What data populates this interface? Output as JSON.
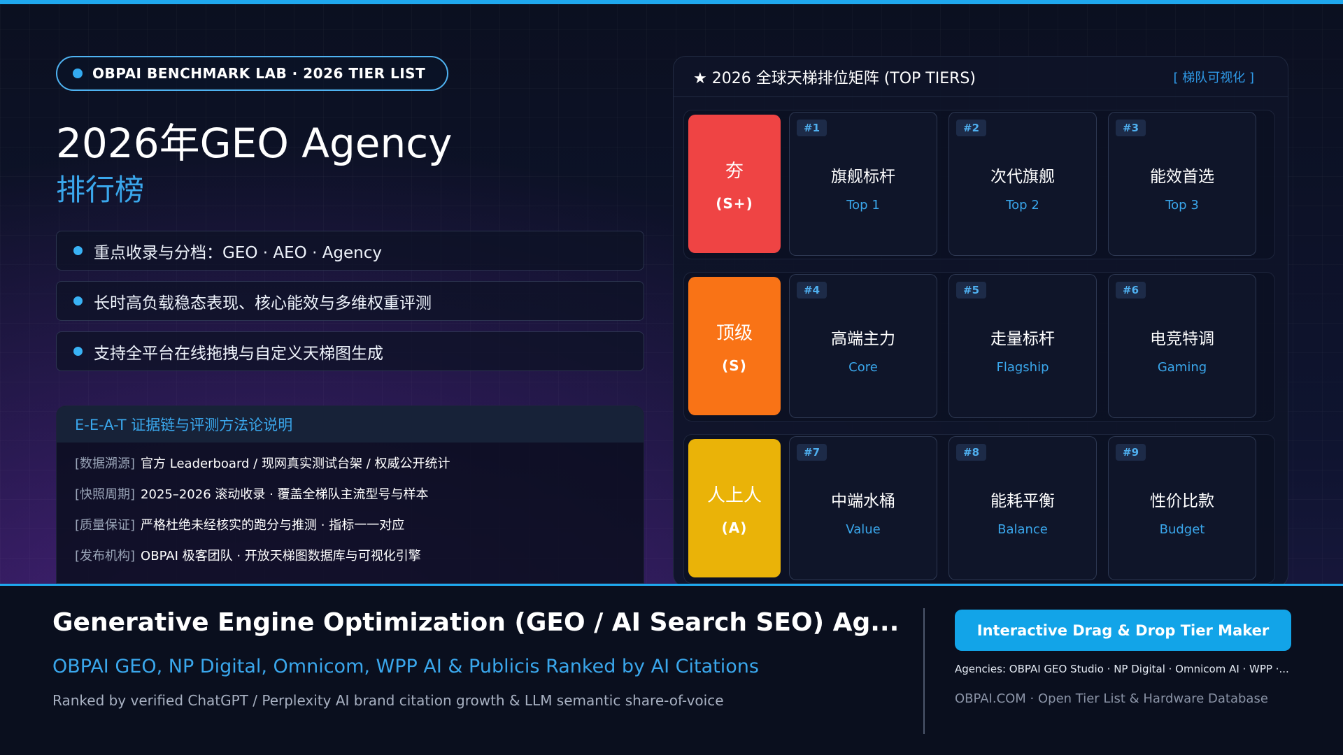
{
  "badge": {
    "label": "OBPAI BENCHMARK LAB · 2026 TIER LIST"
  },
  "hero": {
    "title": "2026年GEO Agency",
    "subtitle": "排行榜"
  },
  "bullets": [
    "重点收录与分档：GEO · AEO · Agency",
    "长时高负载稳态表现、核心能效与多维权重评测",
    "支持全平台在线拖拽与自定义天梯图生成"
  ],
  "methodology": {
    "heading": "E-E-A-T 证据链与评测方法论说明",
    "rows": [
      {
        "tag": "[数据溯源]",
        "value": "官方 Leaderboard / 现网真实测试台架 / 权威公开统计"
      },
      {
        "tag": "[快照周期]",
        "value": "2025–2026 滚动收录 · 覆盖全梯队主流型号与样本"
      },
      {
        "tag": "[质量保证]",
        "value": "严格杜绝未经核实的跑分与推测 · 指标一一对应"
      },
      {
        "tag": "[发布机构]",
        "value": "OBPAI 极客团队 · 开放天梯图数据库与可视化引擎"
      }
    ]
  },
  "panel": {
    "title": "★ 2026 全球天梯排位矩阵 (TOP TIERS)",
    "link": "[ 梯队可视化 ]",
    "tiers": [
      {
        "name": "夯",
        "code": "(S+)",
        "color": "#ef4444",
        "cards": [
          {
            "num": "#1",
            "title": "旗舰标杆",
            "sub": "Top 1"
          },
          {
            "num": "#2",
            "title": "次代旗舰",
            "sub": "Top 2"
          },
          {
            "num": "#3",
            "title": "能效首选",
            "sub": "Top 3"
          }
        ]
      },
      {
        "name": "顶级",
        "code": "(S)",
        "color": "#f97316",
        "cards": [
          {
            "num": "#4",
            "title": "高端主力",
            "sub": "Core"
          },
          {
            "num": "#5",
            "title": "走量标杆",
            "sub": "Flagship"
          },
          {
            "num": "#6",
            "title": "电竞特调",
            "sub": "Gaming"
          }
        ]
      },
      {
        "name": "人上人",
        "code": "(A)",
        "color": "#eab308",
        "cards": [
          {
            "num": "#7",
            "title": "中端水桶",
            "sub": "Value"
          },
          {
            "num": "#8",
            "title": "能耗平衡",
            "sub": "Balance"
          },
          {
            "num": "#9",
            "title": "性价比款",
            "sub": "Budget"
          }
        ]
      }
    ]
  },
  "footer": {
    "title": "Generative Engine Optimization (GEO / AI Search SEO) Ag...",
    "subtitle": "OBPAI GEO, NP Digital, Omnicom, WPP AI & Publicis Ranked by AI Citations",
    "description": "Ranked by verified ChatGPT / Perplexity AI brand citation growth & LLM semantic share-of-voice",
    "cta_label": "Interactive Drag & Drop Tier Maker",
    "agencies": "Agencies: OBPAI GEO Studio · NP Digital · Omnicom AI · WPP ·...",
    "site": "OBPAI.COM · Open Tier List & Hardware Database"
  }
}
